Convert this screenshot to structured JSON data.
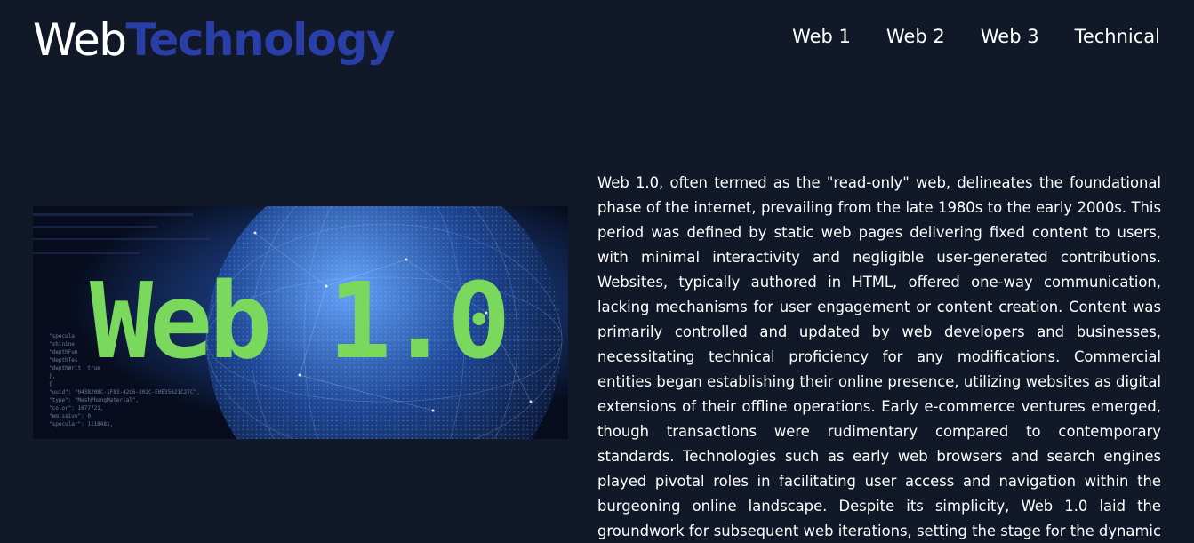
{
  "brand": {
    "part1": "Web",
    "part2": "Technology",
    "colors": {
      "part1": "#ffffff",
      "part2": "#2a3ea8"
    }
  },
  "nav": {
    "items": [
      {
        "label": "Web 1"
      },
      {
        "label": "Web 2"
      },
      {
        "label": "Web 3"
      },
      {
        "label": "Technical"
      }
    ]
  },
  "hero": {
    "title": "Web 1.0",
    "code_snippet": "\"specula\n\"shinine\n\"depthFun\n\"depthTes\n\"depthWrit  true\n},\n{\n\"uuid\": \"0438208C-1F83-42C6-802C-E0E35621C27C\",\n\"type\": \"MeshPhongMaterial\",\n\"color\": 1677721,\n\"emissive\": 0,\n\"specular\": 1118481,",
    "title_color": "#7ad85d"
  },
  "article": {
    "text": "Web 1.0, often termed as the \"read-only\" web, delineates the foundational phase of the internet, prevailing from the late 1980s to the early 2000s. This period was defined by static web pages delivering fixed content to users, with minimal interactivity and negligible user-generated contributions. Websites, typically authored in HTML, offered one-way communication, lacking mechanisms for user engagement or content creation. Content was primarily controlled and updated by web developers and businesses, necessitating technical proficiency for any modifications. Commercial entities began establishing their online presence, utilizing websites as digital extensions of their offline operations. Early e-commerce ventures emerged, though transactions were rudimentary compared to contemporary standards. Technologies such as early web browsers and search engines played pivotal roles in facilitating user access and navigation within the burgeoning online landscape. Despite its simplicity, Web 1.0 laid the groundwork for subsequent web iterations, setting the stage for the dynamic and interactive web"
  },
  "theme": {
    "background": "#111827",
    "text": "#ffffff"
  }
}
